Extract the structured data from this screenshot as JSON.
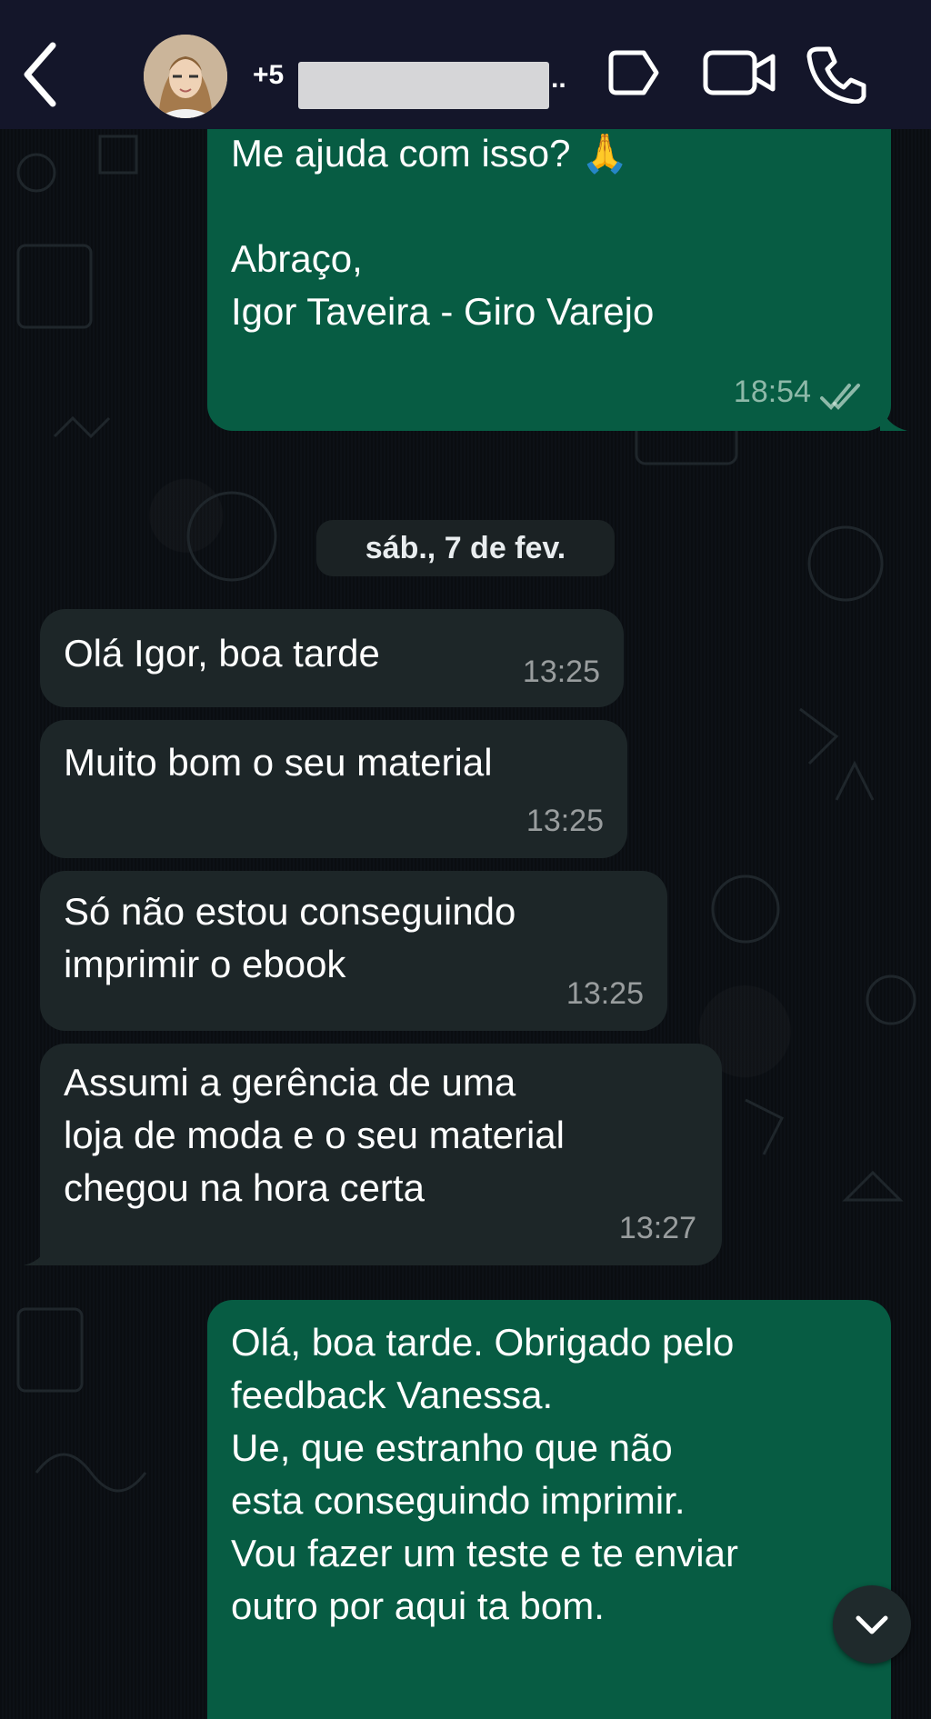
{
  "header": {
    "contact_name_visible": "+5",
    "contact_name_tail": ".."
  },
  "messages": [
    {
      "id": "m1",
      "direction": "out",
      "text": "Me ajuda com isso? 🙏\n\nAbraço,\nIgor Taveira - Giro Varejo",
      "time": "18:54",
      "status": "read"
    },
    {
      "id": "m2",
      "direction": "in",
      "text": "Olá Igor, boa tarde",
      "time": "13:25"
    },
    {
      "id": "m3",
      "direction": "in",
      "text": "Muito bom o seu material",
      "time": "13:25"
    },
    {
      "id": "m4",
      "direction": "in",
      "text": "Só não estou conseguindo\nimprimir o ebook",
      "time": "13:25"
    },
    {
      "id": "m5",
      "direction": "in",
      "text": "Assumi a gerência de uma\nloja de moda e o seu material\nchegou na hora certa",
      "time": "13:27"
    },
    {
      "id": "m6",
      "direction": "out",
      "text": "Olá, boa tarde. Obrigado pelo\nfeedback Vanessa.\nUe, que estranho que não\nesta conseguindo imprimir.\nVou fazer um teste e te enviar\noutro por aqui ta bom."
    }
  ],
  "date_separator": "sáb., 7 de fev.",
  "icons": {
    "back": "chevron-left-icon",
    "label": "label-tag-icon",
    "video": "video-camera-icon",
    "call": "phone-icon",
    "scroll": "chevron-down-icon",
    "read_ticks": "double-check-icon"
  }
}
